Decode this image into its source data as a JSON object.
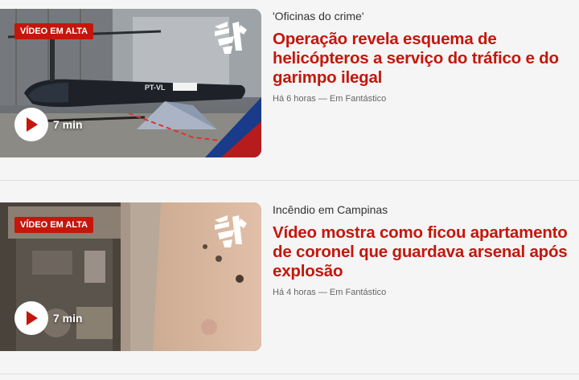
{
  "items": [
    {
      "badge": "VÍDEO EM ALTA",
      "duration": "7 min",
      "kicker": "'Oficinas do crime'",
      "headline": "Operação revela esquema de helicópteros a serviço do tráfico e do garimpo ilegal",
      "meta": "Há 6 horas — Em Fantástico",
      "thumb_text": "PT-VL"
    },
    {
      "badge": "VÍDEO EM ALTA",
      "duration": "7 min",
      "kicker": "Incêndio em Campinas",
      "headline": "Vídeo mostra como ficou apartamento de coronel que guardava arsenal após explosão",
      "meta": "Há 4 horas — Em Fantástico"
    }
  ],
  "colors": {
    "accent": "#c4170c",
    "meta": "#666666",
    "background": "#f5f5f5"
  },
  "icons": {
    "play": "play-icon",
    "logo": "fantastico-logo-icon"
  }
}
